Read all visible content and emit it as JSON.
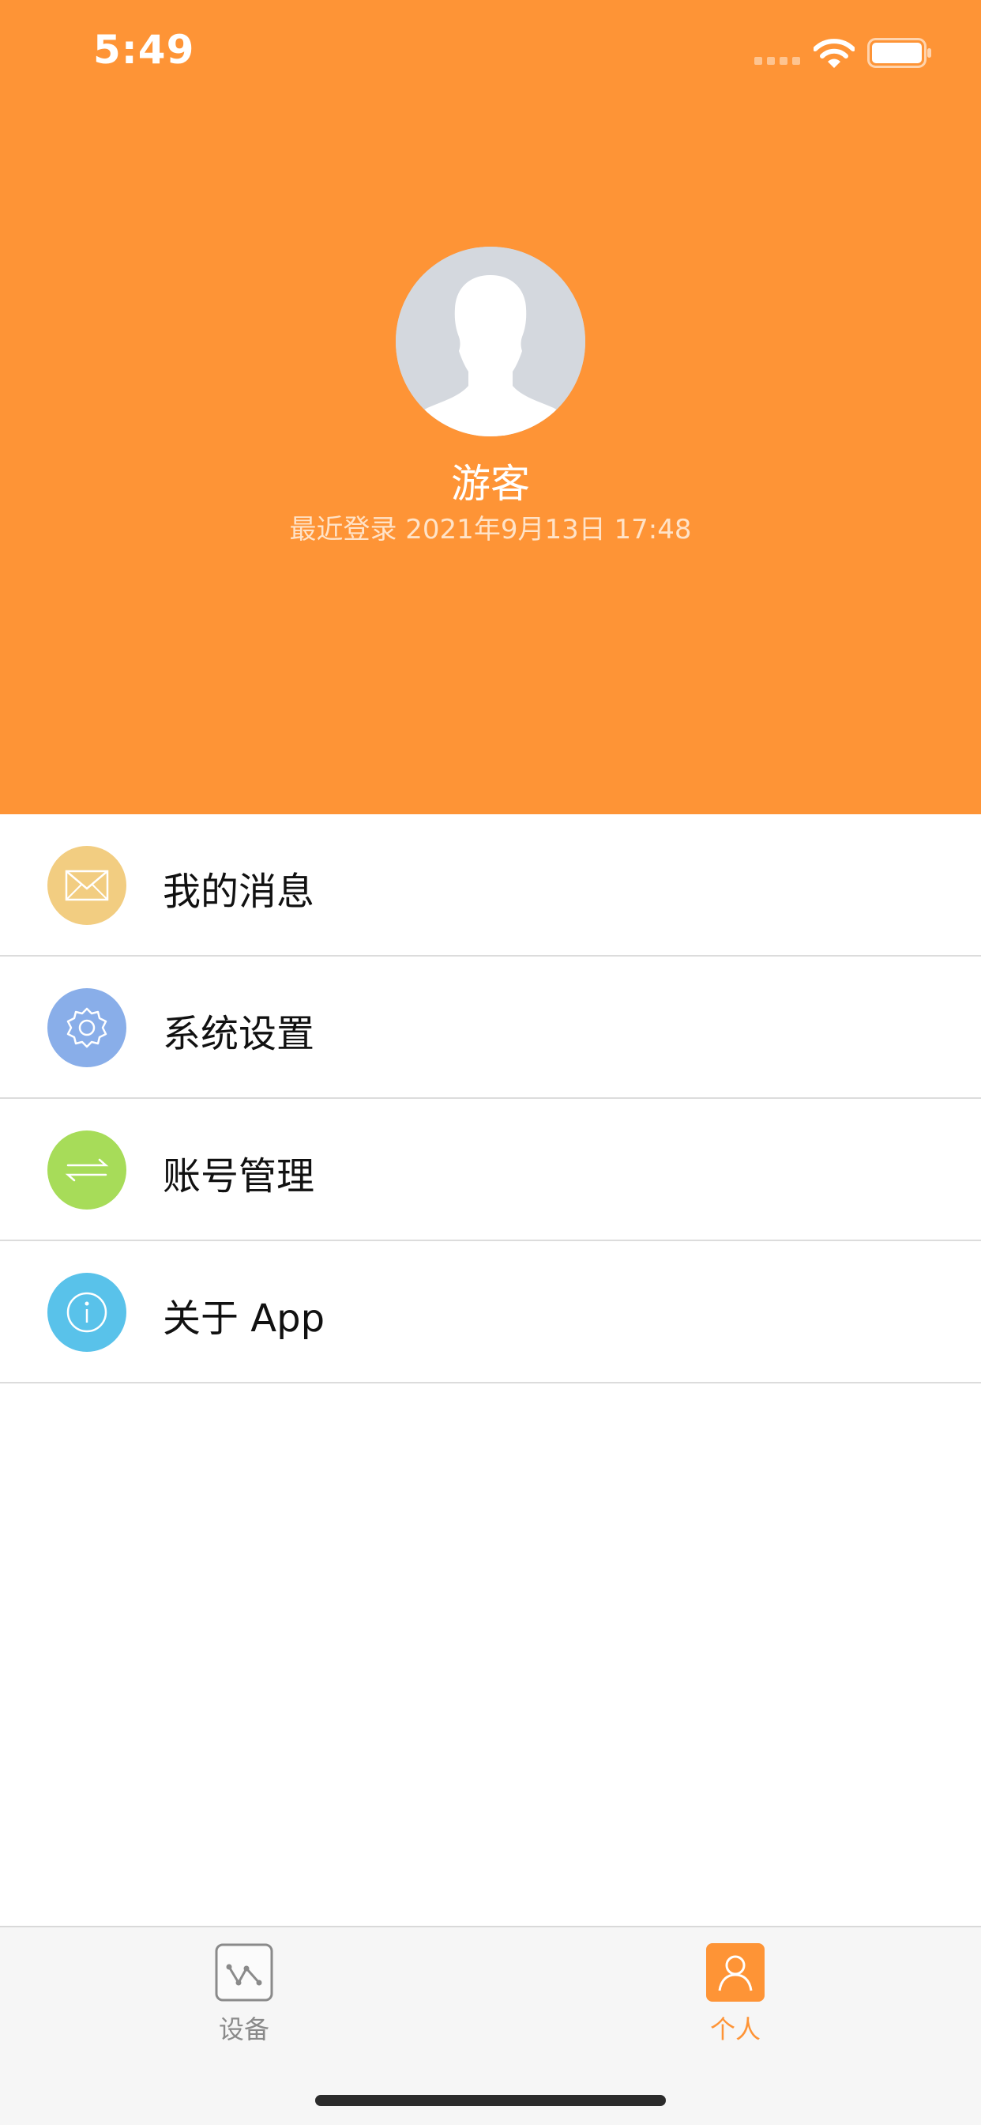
{
  "status_bar": {
    "time": "5:49"
  },
  "profile": {
    "name": "游客",
    "last_login": "最近登录 2021年9月13日 17:48"
  },
  "menu": {
    "items": [
      {
        "label": "我的消息",
        "icon": "envelope-icon",
        "color": "#f2cd81"
      },
      {
        "label": "系统设置",
        "icon": "gear-icon",
        "color": "#89aee9"
      },
      {
        "label": "账号管理",
        "icon": "switch-arrows-icon",
        "color": "#a7dc59"
      },
      {
        "label": "关于 App",
        "icon": "info-icon",
        "color": "#59c2ea"
      }
    ]
  },
  "tabbar": {
    "tabs": [
      {
        "label": "设备",
        "icon": "devices-chart-icon",
        "active": false
      },
      {
        "label": "个人",
        "icon": "person-icon",
        "active": true
      }
    ],
    "active_color": "#fe9436",
    "inactive_color": "#8a8a8a"
  },
  "colors": {
    "header_bg": "#fe9436"
  }
}
